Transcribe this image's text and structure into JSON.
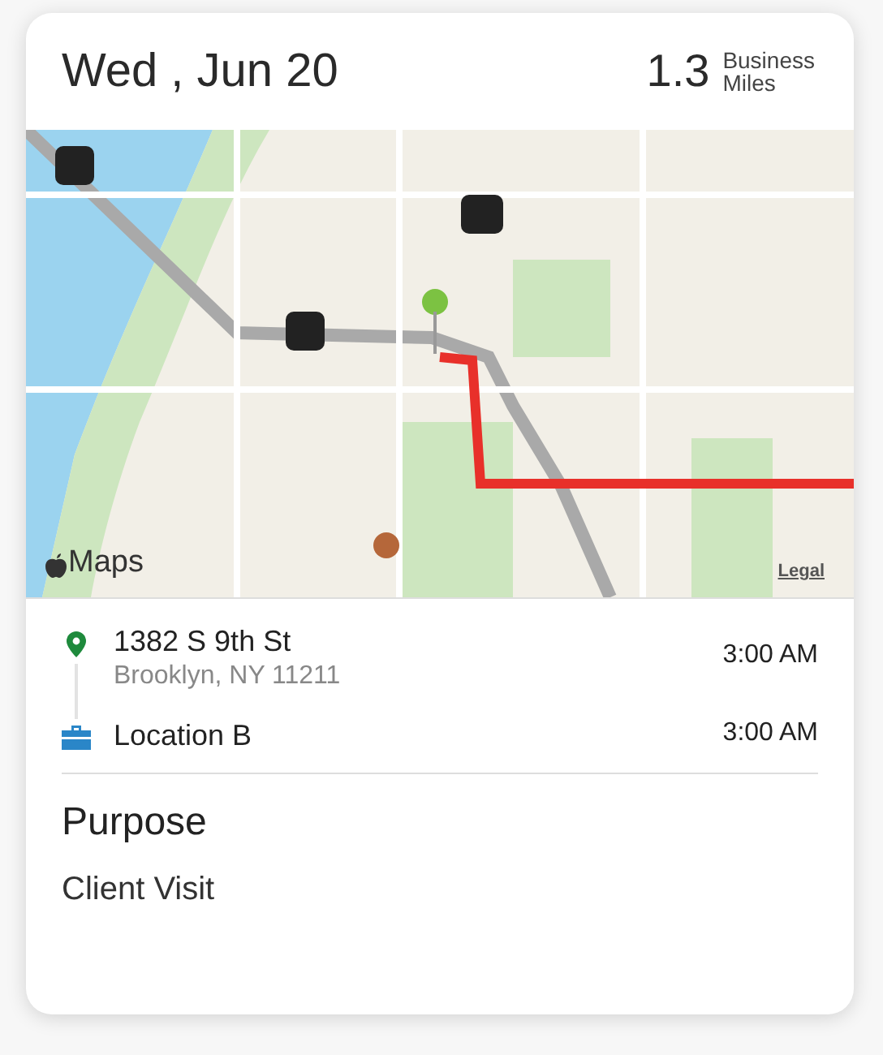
{
  "header": {
    "date": "Wed , Jun 20",
    "miles": "1.3",
    "miles_label": [
      "Business",
      "Miles"
    ]
  },
  "map": {
    "kind": "picture",
    "attribution": "Maps",
    "legal": "Legal"
  },
  "stops": [
    {
      "kind": "start",
      "address": "1382 S 9th St",
      "detail": "Brooklyn, NY 11211",
      "time": "3:00 AM"
    },
    {
      "kind": "business",
      "address": "Location B",
      "time": "3:00 AM"
    }
  ],
  "purpose": {
    "title": "Purpose",
    "value": "Client Visit"
  }
}
